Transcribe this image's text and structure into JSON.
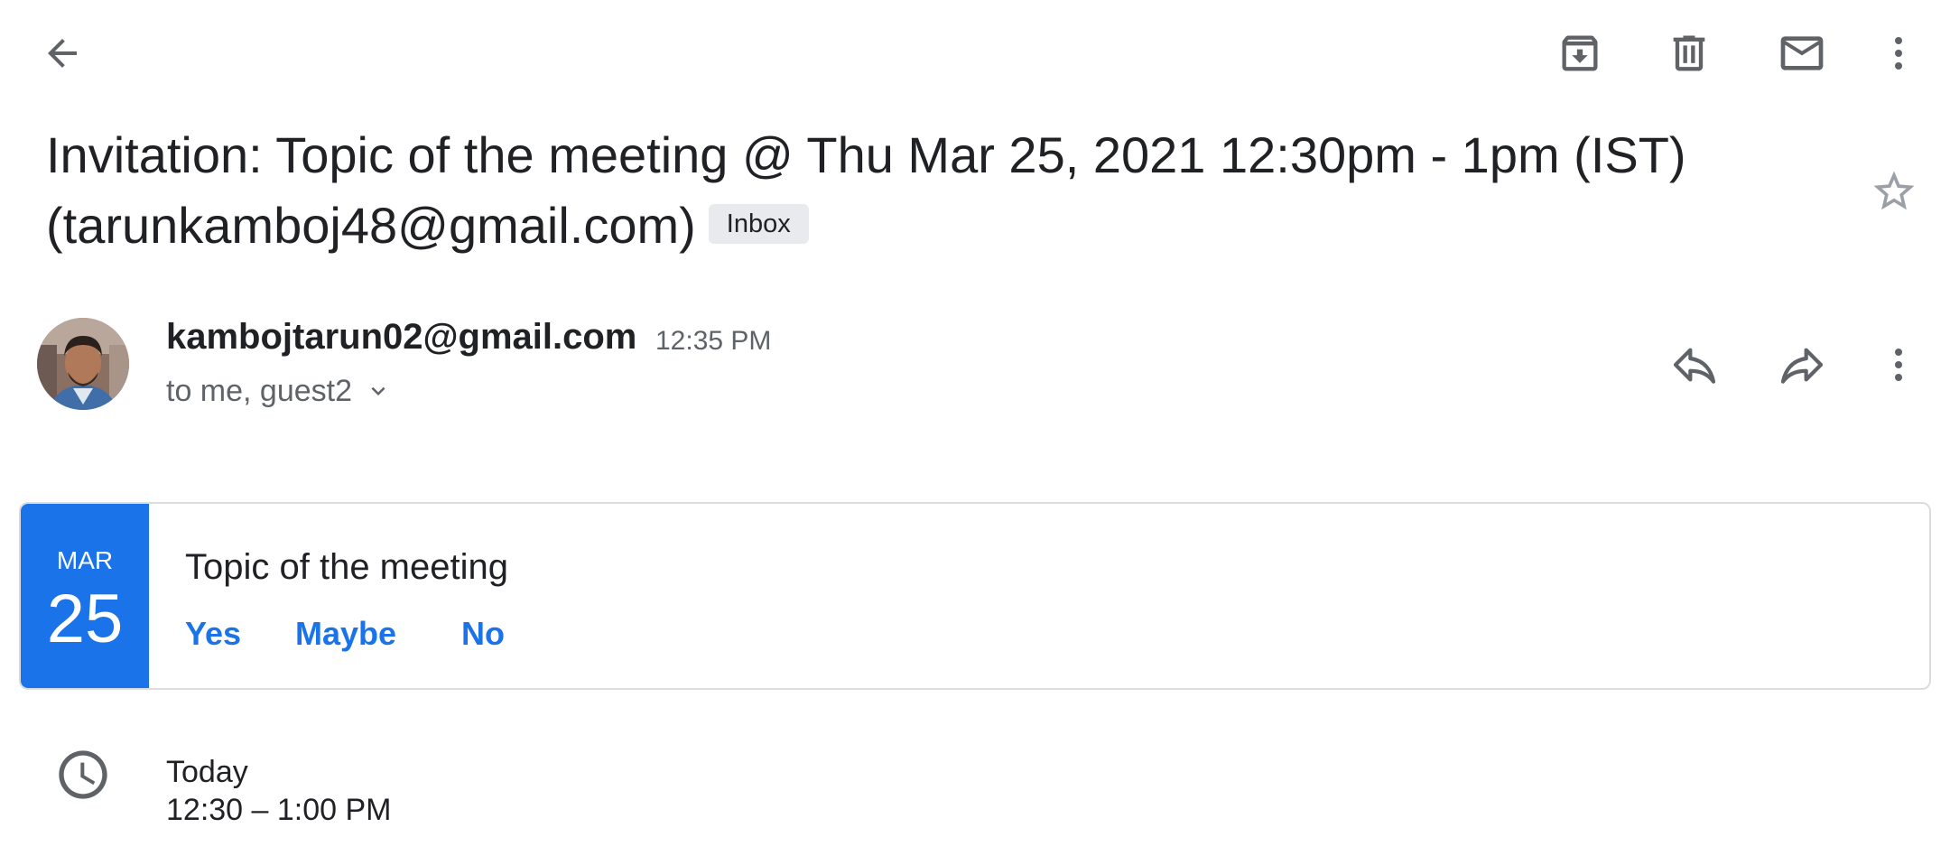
{
  "toolbar": {
    "back_icon": "arrow-left-icon",
    "archive_icon": "archive-icon",
    "delete_icon": "trash-icon",
    "mark_unread_icon": "mail-icon",
    "more_icon": "more-vert-icon"
  },
  "subject": {
    "line1": "Invitation: Topic of the meeting @ Thu Mar 25, 2021 12:30pm - 1pm (IST)",
    "line2": "(tarunkamboj48@gmail.com)",
    "label": "Inbox",
    "star_icon": "star-outline-icon"
  },
  "message": {
    "sender": "kambojtarun02@gmail.com",
    "time": "12:35 PM",
    "recipients": "to me, guest2",
    "reply_icon": "reply-icon",
    "forward_icon": "forward-icon",
    "more_icon": "more-vert-icon"
  },
  "event": {
    "month": "MAR",
    "day": "25",
    "title": "Topic of the meeting",
    "rsvp_yes": "Yes",
    "rsvp_maybe": "Maybe",
    "rsvp_no": "No"
  },
  "schedule": {
    "day": "Today",
    "time_range": "12:30 – 1:00 PM",
    "icon": "clock-icon"
  },
  "colors": {
    "accent": "#1a73e8",
    "icon": "#5f6368",
    "text": "#202124",
    "badge_bg": "#e8eaed"
  }
}
